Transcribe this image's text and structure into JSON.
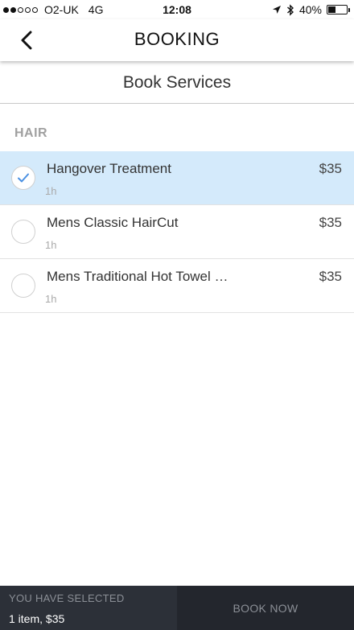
{
  "status_bar": {
    "carrier": "O2-UK",
    "network": "4G",
    "time": "12:08",
    "battery": "40%",
    "battery_level": 0.4
  },
  "nav": {
    "title": "BOOKING"
  },
  "page": {
    "subtitle": "Book Services"
  },
  "category": {
    "label": "HAIR"
  },
  "services": [
    {
      "name": "Hangover Treatment",
      "duration": "1h",
      "price": "$35",
      "selected": true
    },
    {
      "name": "Mens Classic HairCut",
      "duration": "1h",
      "price": "$35",
      "selected": false
    },
    {
      "name": "Mens Traditional Hot Towel …",
      "duration": "1h",
      "price": "$35",
      "selected": false
    }
  ],
  "summary": {
    "label": "YOU HAVE SELECTED",
    "value": "1 item, $35"
  },
  "actions": {
    "book_now_label": "BOOK NOW"
  },
  "colors": {
    "selected_row": "#d4eafb",
    "check_accent": "#4a90e2",
    "bottom_bar": "#2c3038"
  }
}
